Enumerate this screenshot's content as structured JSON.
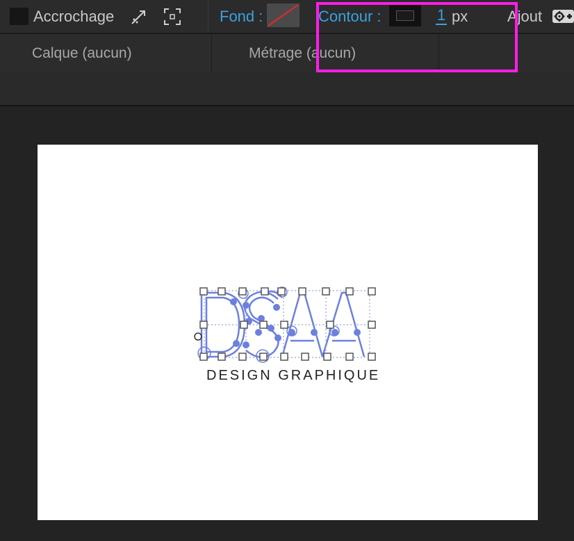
{
  "toolbar": {
    "snap_label": "Accrochage",
    "fill_label": "Fond :",
    "stroke_label": "Contour :",
    "stroke_width_value": "1",
    "stroke_width_unit": "px",
    "add_label": "Ajout",
    "colors": {
      "label_accent": "#39a1e0",
      "highlight": "#ff1ee8",
      "shape_path": "#6c80e0"
    }
  },
  "panels": {
    "layer_label": "Calque  (aucun)",
    "footage_label": "Métrage  (aucun)"
  },
  "composition": {
    "logo_text": "DSAA",
    "subtitle": "DESIGN GRAPHIQUE"
  }
}
